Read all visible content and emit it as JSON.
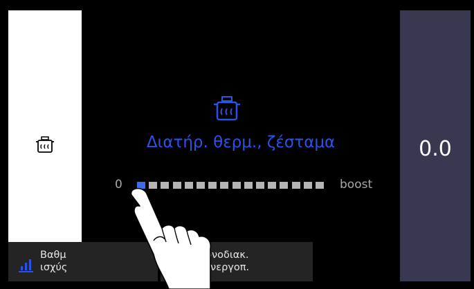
{
  "left": {
    "icon": "pot-steam-icon"
  },
  "center": {
    "mode_icon": "pot-steam-icon",
    "mode_title": "Διατήρ. θερμ., ζέσταμα",
    "power": {
      "min_label": "0",
      "max_label": "boost",
      "segments_total": 16,
      "level": 1
    }
  },
  "right": {
    "timer_value": "0.0"
  },
  "buttons": {
    "power": {
      "icon": "power-level-icon",
      "line1": "Βαθμ",
      "line2": "ισχύς"
    },
    "timer": {
      "icon": "timer-arrow-icon",
      "line1": "Χρονοδιακ.",
      "line2": "απενεργοπ."
    }
  },
  "colors": {
    "accent": "#2b53e6",
    "right_panel": "#383850",
    "segment_active": "#3a6cf0",
    "segment_inactive": "#b5b5b5"
  }
}
